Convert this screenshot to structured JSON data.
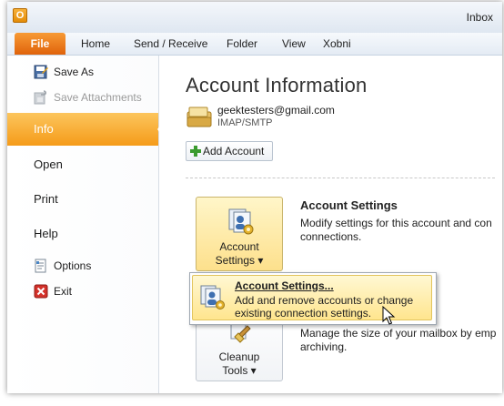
{
  "window": {
    "title": "Inbox",
    "app_icon_letter": "O"
  },
  "ribbon": {
    "tabs": [
      "File",
      "Home",
      "Send / Receive",
      "Folder",
      "View",
      "Xobni"
    ],
    "active_tab": "File"
  },
  "backstage_nav": {
    "items": [
      {
        "label": "Save As",
        "kind": "small",
        "state": "normal",
        "icon": "save-as-icon"
      },
      {
        "label": "Save Attachments",
        "kind": "small",
        "state": "disabled",
        "icon": "save-attachments-icon"
      },
      {
        "label": "Info",
        "kind": "big",
        "state": "active"
      },
      {
        "label": "Open",
        "kind": "big",
        "state": "normal"
      },
      {
        "label": "Print",
        "kind": "big",
        "state": "normal"
      },
      {
        "label": "Help",
        "kind": "big",
        "state": "normal"
      },
      {
        "label": "Options",
        "kind": "small",
        "state": "normal",
        "icon": "options-icon"
      },
      {
        "label": "Exit",
        "kind": "small",
        "state": "normal",
        "icon": "exit-icon"
      }
    ]
  },
  "main": {
    "title": "Account Information",
    "account": {
      "email": "geektesters@gmail.com",
      "type": "IMAP/SMTP"
    },
    "add_account_label": "Add Account",
    "account_settings": {
      "button_line1": "Account",
      "button_line2": "Settings ▾",
      "heading": "Account Settings",
      "description": "Modify settings for this account and con connections."
    },
    "cleanup": {
      "button_line1": "Cleanup",
      "button_line2": "Tools ▾",
      "description_line1": "Manage the size of your mailbox by emp",
      "description_line2": "archiving."
    }
  },
  "dropdown": {
    "item_title": "Account Settings...",
    "item_description": "Add and remove accounts or change existing connection settings."
  },
  "colors": {
    "file_tab": "#e0630b",
    "active_nav": "#f59b19",
    "highlight": "#ffe58e"
  }
}
